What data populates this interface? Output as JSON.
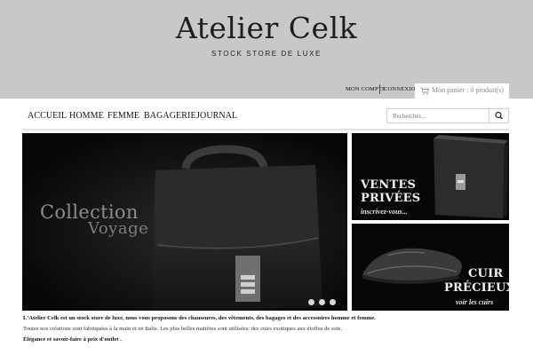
{
  "brand": {
    "title": "Atelier Celk",
    "tagline": "STOCK STORE DE LUXE"
  },
  "account": {
    "my_account": "MON COMPTE",
    "login": "CONNEXION",
    "cart_label": "Mon panier : 0 produit(s)"
  },
  "nav": {
    "items": [
      "ACCUEIL",
      "HOMME",
      "FEMME",
      "BAGAGERIE",
      "JOURNAL"
    ],
    "search_placeholder": "Rechercher..."
  },
  "hero": {
    "line1": "Collection",
    "line2": "Voyage",
    "slides": 3,
    "active_slide": 1
  },
  "banners": [
    {
      "title_line1": "VENTES",
      "title_line2": "PRIVÉES",
      "subtitle": "inscrivez-vous..."
    },
    {
      "title_line1": "CUIR",
      "title_line2": "PRÉCIEUX",
      "subtitle": "voir les cuirs"
    }
  ],
  "description": {
    "line1": "L'Atelier Celk est un stock store de luxe, nous vous proposons des chaussures, des vêtements, des bagages et des accessoires homme et femme.",
    "line2": "Toutes nos créations sont fabriquées à la main et en Italie. Les plus belles matières sont utilisées: des cuirs exotiques aux étoffes de soie.",
    "line3": "Élégance et savoir-faire à prix d'outlet ."
  },
  "colors": {
    "header_bg": "#c8c8c8",
    "hero_bg": "#080808"
  }
}
